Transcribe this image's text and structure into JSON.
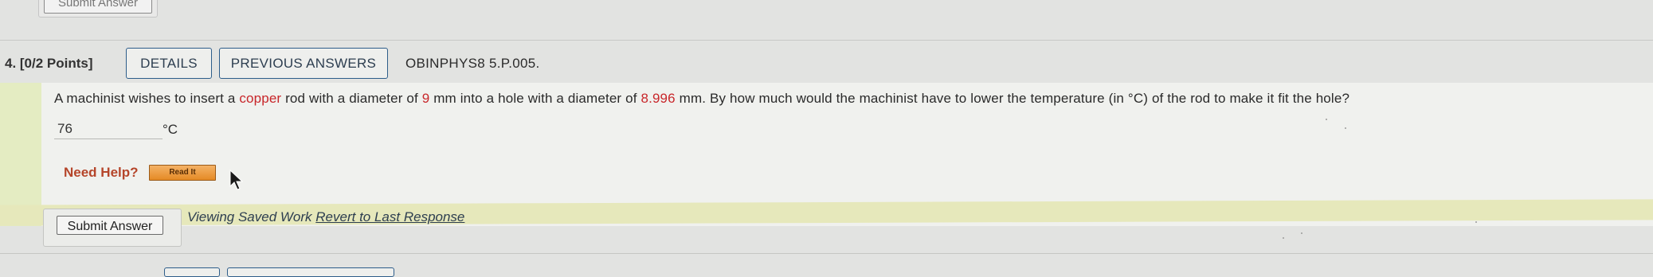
{
  "previous_question": {
    "submit_label": "Submit Answer"
  },
  "question": {
    "number_points": "4.  [0/2 Points]",
    "details_label": "DETAILS",
    "previous_answers_label": "PREVIOUS ANSWERS",
    "code": "OBINPHYS8 5.P.005.",
    "text_1": "A machinist wishes to insert a ",
    "text_copper": "copper",
    "text_2": " rod with a diameter of ",
    "text_diam1": "9",
    "text_3": " mm into a hole with a diameter of ",
    "text_diam2": "8.996",
    "text_4": " mm. By how much would the machinist have to lower the temperature (in °C) of the rod to make it fit the hole?",
    "answer_value": "76",
    "unit": "°C",
    "need_help_label": "Need Help?",
    "read_it_label": "Read It",
    "submit_label": "Submit Answer",
    "viewing_saved_text": "Viewing Saved Work",
    "revert_link_text": "Revert to Last Response"
  },
  "colors": {
    "highlight_red": "#c8262a",
    "tab_border": "#2d5d8a",
    "need_help": "#b5452a",
    "saved_band": "#e6e8bb"
  },
  "icons": {
    "cursor": "arrow-cursor-icon"
  }
}
